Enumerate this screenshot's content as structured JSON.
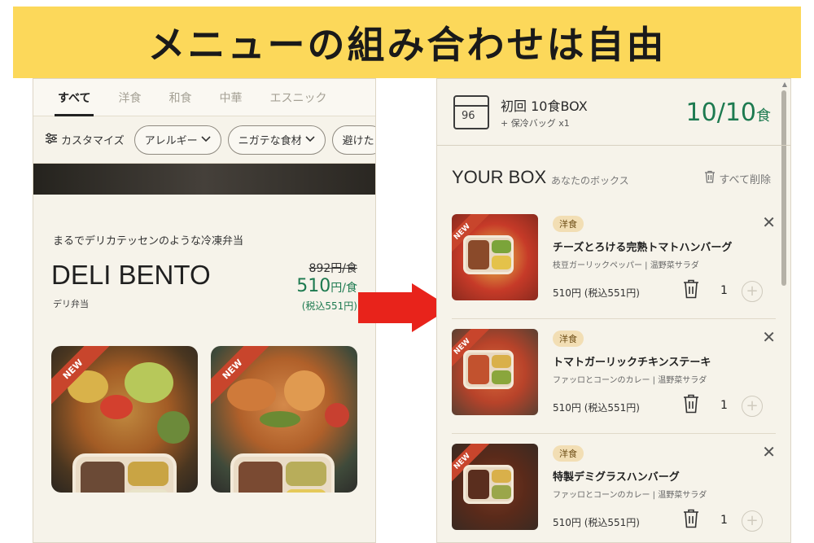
{
  "banner": {
    "title": "メニューの組み合わせは自由"
  },
  "menu": {
    "tabs": [
      {
        "label": "すべて",
        "active": true
      },
      {
        "label": "洋食"
      },
      {
        "label": "和食"
      },
      {
        "label": "中華"
      },
      {
        "label": "エスニック"
      }
    ],
    "customize_label": "カスタマイズ",
    "filters": [
      {
        "label": "アレルギー"
      },
      {
        "label": "ニガテな食材"
      },
      {
        "label": "避けた"
      }
    ]
  },
  "deli": {
    "tagline": "まるでデリカテッセンのような冷凍弁当",
    "title": "DELI BENTO",
    "subtitle": "デリ弁当",
    "old_price": "892円/食",
    "price_value": "510",
    "price_unit": "円/食",
    "price_tax": "(税込551円)",
    "new_badge": "NEW"
  },
  "box": {
    "icon_label": "96",
    "title": "初回 10食BOX",
    "subtitle": "+ 保冷バッグ x1",
    "count": "10/10",
    "count_unit": "食",
    "your_box_title": "YOUR BOX",
    "your_box_sub": "あなたのボックス",
    "clear_all": "すべて削除",
    "items": [
      {
        "category": "洋食",
        "name": "チーズとろける完熟トマトハンバーグ",
        "sides": "枝豆ガーリックペッパー | 温野菜サラダ",
        "price": "510円 (税込551円)",
        "qty": "1",
        "badge": "NEW"
      },
      {
        "category": "洋食",
        "name": "トマトガーリックチキンステーキ",
        "sides": "ファッロとコーンのカレー | 温野菜サラダ",
        "price": "510円 (税込551円)",
        "qty": "1",
        "badge": "NEW"
      },
      {
        "category": "洋食",
        "name": "特製デミグラスハンバーグ",
        "sides": "ファッロとコーンのカレー | 温野菜サラダ",
        "price": "510円 (税込551円)",
        "qty": "1",
        "badge": "NEW"
      }
    ]
  },
  "colors": {
    "banner": "#fcd85a",
    "accent_green": "#1d7a50",
    "arrow": "#e8231b",
    "badge_red": "#c8452c",
    "category_bg": "#f2deb4"
  },
  "icons": {
    "customize": "sliders-icon",
    "chevron": "chevron-down-icon",
    "trash": "trash-icon",
    "close": "close-icon",
    "plus": "plus-circle-icon",
    "box": "box-icon"
  }
}
